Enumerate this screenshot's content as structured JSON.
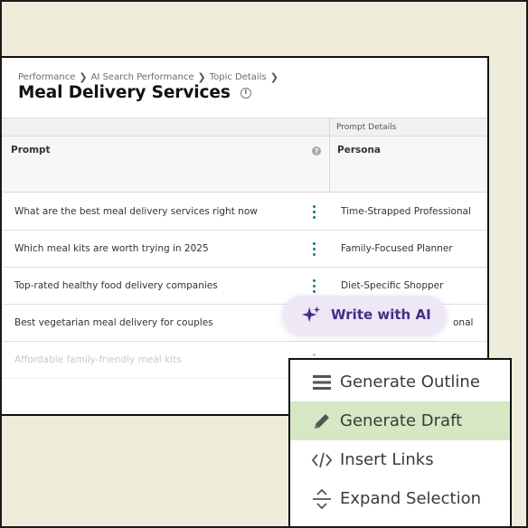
{
  "breadcrumb": [
    "Performance",
    "AI Search Performance",
    "Topic Details"
  ],
  "page_title": "Meal Delivery Services",
  "table": {
    "group_header": "Prompt Details",
    "columns": {
      "prompt": "Prompt",
      "persona": "Persona"
    },
    "rows": [
      {
        "prompt": "What are the best meal delivery services right now",
        "persona": "Time-Strapped Professional"
      },
      {
        "prompt": "Which meal kits are worth trying in 2025",
        "persona": "Family-Focused Planner"
      },
      {
        "prompt": "Top-rated healthy food delivery companies",
        "persona": "Diet-Specific Shopper"
      },
      {
        "prompt": "Best vegetarian meal delivery for couples",
        "persona": "onal"
      },
      {
        "prompt": "Affordable family-friendly meal kits",
        "persona": ""
      }
    ]
  },
  "ai_button": {
    "label": "Write with AI",
    "icon": "sparkle-icon",
    "color": "#472d85",
    "bg": "#ede7f6"
  },
  "menu": {
    "items": [
      {
        "label": "Generate Outline",
        "icon": "list-icon"
      },
      {
        "label": "Generate Draft",
        "icon": "pencil-icon",
        "highlight": "#d6e7c4"
      },
      {
        "label": "Insert Links",
        "icon": "code-icon"
      },
      {
        "label": "Expand Selection",
        "icon": "expand-icon"
      }
    ]
  },
  "colors": {
    "background": "#f0ecdc",
    "kebab": "#127a86"
  }
}
